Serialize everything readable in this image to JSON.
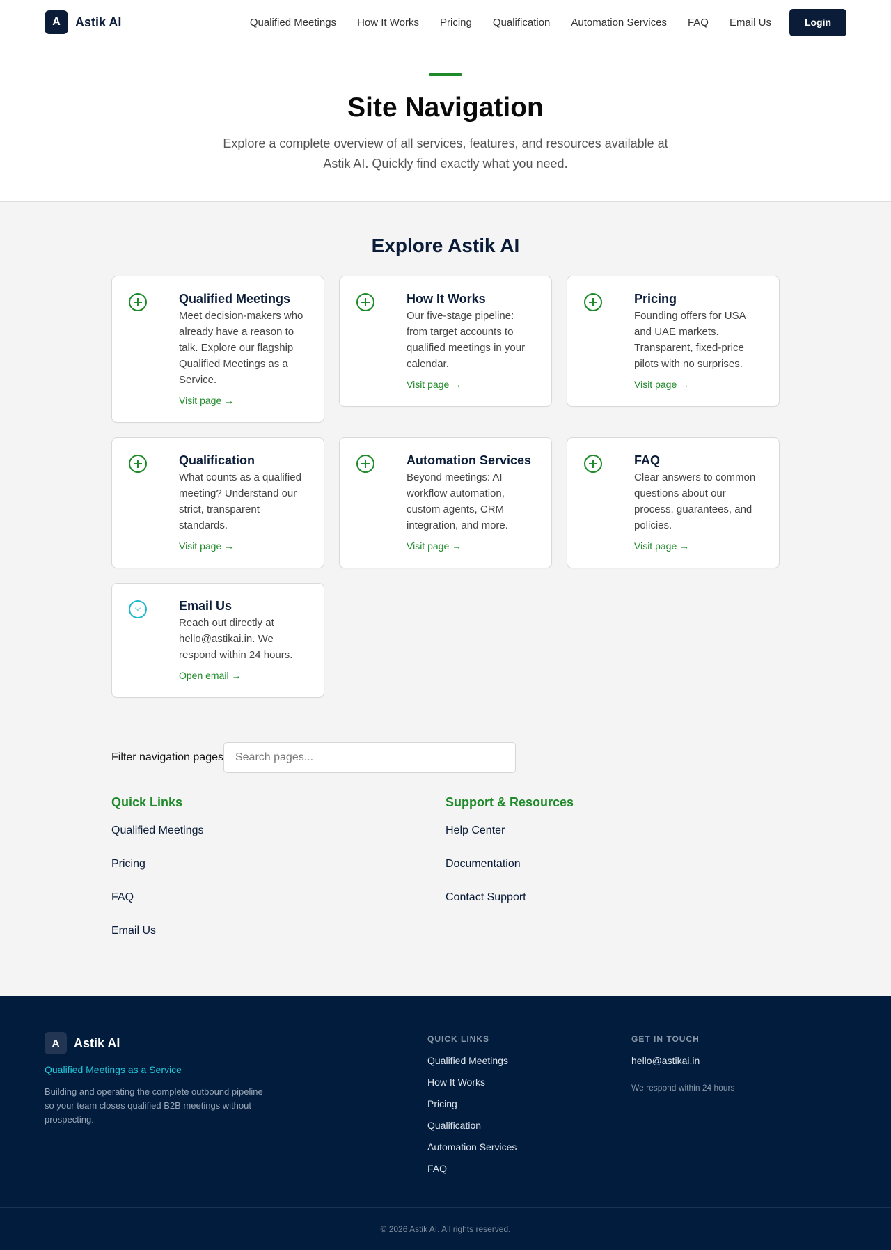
{
  "header": {
    "logo_letter": "A",
    "brand": "Astik AI",
    "nav": [
      "Qualified Meetings",
      "How It Works",
      "Pricing",
      "Qualification",
      "Automation Services",
      "FAQ",
      "Email Us"
    ],
    "login_label": "Login"
  },
  "hero": {
    "title": "Site Navigation",
    "subtitle": "Explore a complete overview of all services, features, and resources available at Astik AI. Quickly find exactly what you need."
  },
  "explore": {
    "title": "Explore Astik AI",
    "cards": [
      {
        "title": "Qualified Meetings",
        "desc": "Meet decision-makers who already have a reason to talk. Explore our flagship Qualified Meetings as a Service.",
        "link": "Visit page →",
        "icon": "plus-circle-icon"
      },
      {
        "title": "How It Works",
        "desc": "Our five-stage pipeline: from target accounts to qualified meetings in your calendar.",
        "link": "Visit page →",
        "icon": "plus-circle-icon"
      },
      {
        "title": "Pricing",
        "desc": "Founding offers for USA and UAE markets. Transparent, fixed-price pilots with no surprises.",
        "link": "Visit page →",
        "icon": "plus-circle-icon"
      },
      {
        "title": "Qualification",
        "desc": "What counts as a qualified meeting? Understand our strict, transparent standards.",
        "link": "Visit page →",
        "icon": "plus-circle-icon"
      },
      {
        "title": "Automation Services",
        "desc": "Beyond meetings: AI workflow automation, custom agents, CRM integration, and more.",
        "link": "Visit page →",
        "icon": "plus-circle-icon"
      },
      {
        "title": "FAQ",
        "desc": "Clear answers to common questions about our process, guarantees, and policies.",
        "link": "Visit page →",
        "icon": "plus-circle-icon"
      },
      {
        "title": "Email Us",
        "desc": "Reach out directly at hello@astikai.in. We respond within 24 hours.",
        "link": "Open email →",
        "icon": "chevron-circle-icon"
      }
    ]
  },
  "filter": {
    "label": "Filter navigation pages",
    "placeholder": "Search pages..."
  },
  "quick_links": {
    "title": "Quick Links",
    "items": [
      "Qualified Meetings",
      "Pricing",
      "FAQ",
      "Email Us"
    ]
  },
  "support": {
    "title": "Support & Resources",
    "items": [
      "Help Center",
      "Documentation",
      "Contact Support"
    ]
  },
  "footer": {
    "logo_letter": "A",
    "brand": "Astik AI",
    "tagline": "Qualified Meetings as a Service",
    "description": "Building and operating the complete outbound pipeline so your team closes qualified B2B meetings without prospecting.",
    "quick_links_title": "QUICK LINKS",
    "quick_links": [
      "Qualified Meetings",
      "How It Works",
      "Pricing",
      "Qualification",
      "Automation Services",
      "FAQ"
    ],
    "contact_title": "GET IN TOUCH",
    "email": "hello@astikai.in",
    "respond": "We respond within 24 hours",
    "copyright": "© 2026 Astik AI. All rights reserved."
  },
  "colors": {
    "navy": "#0b1c38",
    "green": "#1f8a2a",
    "cyan": "#22c5d8",
    "footer_bg": "#011c3c"
  }
}
